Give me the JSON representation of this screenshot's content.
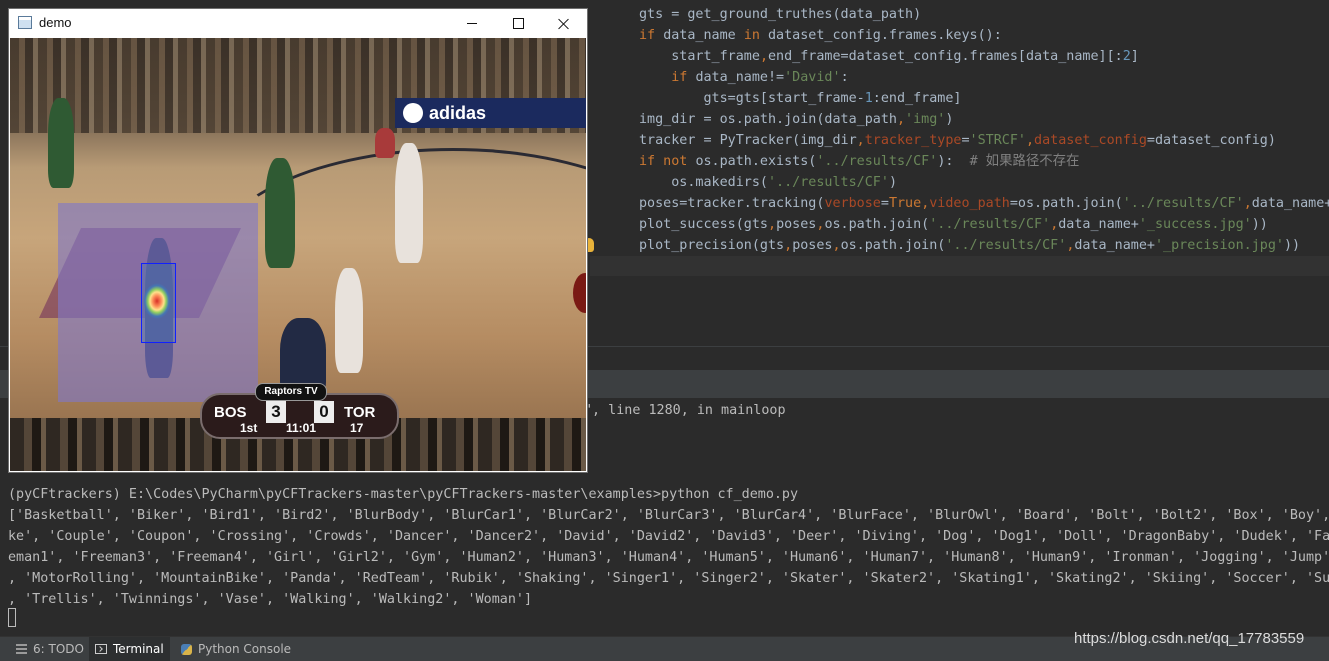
{
  "editor": {
    "lines": [
      "gts = get_ground_truthes(data_path)",
      "if data_name in dataset_config.frames.keys():",
      "    start_frame,end_frame=dataset_config.frames[data_name][:2]",
      "    if data_name!='David':",
      "        gts=gts[start_frame-1:end_frame]",
      "img_dir = os.path.join(data_path,'img')",
      "tracker = PyTracker(img_dir,tracker_type='STRCF',dataset_config=dataset_config)",
      "if not os.path.exists('../results/CF'):  # 如果路径不存在",
      "    os.makedirs('../results/CF')",
      "poses=tracker.tracking(verbose=True,video_path=os.path.join('../results/CF',data_name+",
      "plot_success(gts,poses,os.path.join('../results/CF',data_name+'_success.jpg'))",
      "plot_precision(gts,poses,os.path.join('../results/CF',data_name+'_precision.jpg'))"
    ]
  },
  "terminal": {
    "error_tail": "\", line 1280, in mainloop",
    "prompt": "(pyCFtrackers) E:\\Codes\\PyCharm\\pyCFTrackers-master\\pyCFTrackers-master\\examples>python cf_demo.py",
    "output": [
      "['Basketball', 'Biker', 'Bird1', 'Bird2', 'BlurBody', 'BlurCar1', 'BlurCar2', 'BlurCar3', 'BlurCar4', 'BlurFace', 'BlurOwl', 'Board', 'Bolt', 'Bolt2', 'Box', 'Boy',",
      "ke', 'Couple', 'Coupon', 'Crossing', 'Crowds', 'Dancer', 'Dancer2', 'David', 'David2', 'David3', 'Deer', 'Diving', 'Dog', 'Dog1', 'Doll', 'DragonBaby', 'Dudek', 'Fac",
      "eman1', 'Freeman3', 'Freeman4', 'Girl', 'Girl2', 'Gym', 'Human2', 'Human3', 'Human4', 'Human5', 'Human6', 'Human7', 'Human8', 'Human9', 'Ironman', 'Jogging', 'Jump',",
      ", 'MotorRolling', 'MountainBike', 'Panda', 'RedTeam', 'Rubik', 'Shaking', 'Singer1', 'Singer2', 'Skater', 'Skater2', 'Skating1', 'Skating2', 'Skiing', 'Soccer', 'Sub",
      ", 'Trellis', 'Twinnings', 'Vase', 'Walking', 'Walking2', 'Woman']"
    ]
  },
  "statusbar": {
    "todo_label": "6: TODO",
    "terminal_label": "Terminal",
    "python_console_label": "Python Console"
  },
  "watermark": "https://blog.csdn.net/qq_17783559",
  "demo_window": {
    "title": "demo",
    "video": {
      "ad_text": "adidas",
      "tv_badge": "Raptors TV",
      "team_left": "BOS",
      "score_left": "3",
      "score_right": "0",
      "team_right": "TOR",
      "quarter": "1st",
      "clock": "11:01",
      "shot_clock": "17"
    }
  }
}
